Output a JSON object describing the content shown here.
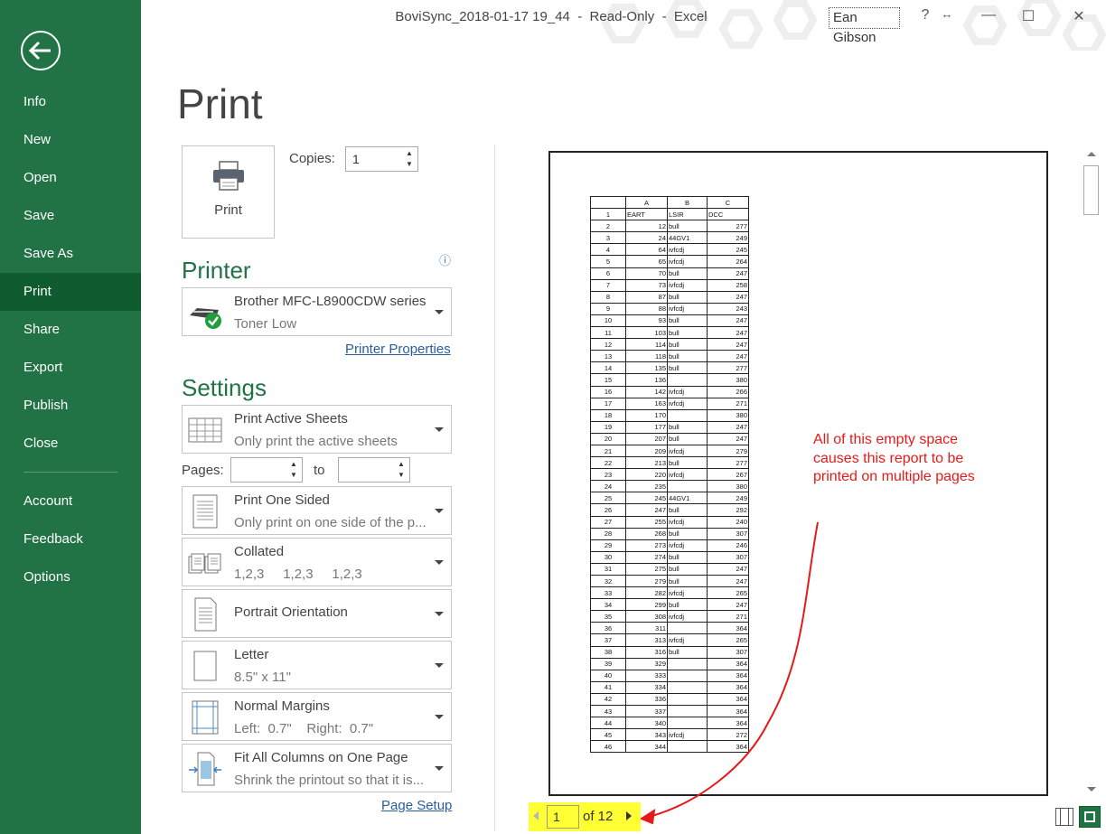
{
  "window": {
    "title": "BoviSync_2018-01-17 19_44  -  Read-Only  -  Excel",
    "user": "Ean Gibson",
    "help": "?",
    "minimize": "—",
    "maximize": "☐",
    "close": "✕"
  },
  "sidebar": {
    "items": [
      {
        "label": "Info"
      },
      {
        "label": "New"
      },
      {
        "label": "Open"
      },
      {
        "label": "Save"
      },
      {
        "label": "Save As"
      },
      {
        "label": "Print",
        "active": true
      },
      {
        "label": "Share"
      },
      {
        "label": "Export"
      },
      {
        "label": "Publish"
      },
      {
        "label": "Close"
      },
      {
        "label": "Account"
      },
      {
        "label": "Feedback"
      },
      {
        "label": "Options"
      }
    ]
  },
  "print": {
    "heading": "Print",
    "button_label": "Print",
    "copies_label": "Copies:",
    "copies_value": "1",
    "printer_heading": "Printer",
    "printer_name": "Brother MFC-L8900CDW series",
    "printer_status": "Toner Low",
    "printer_properties": "Printer Properties",
    "settings_heading": "Settings",
    "pages_label": "Pages:",
    "pages_to": "to",
    "page_setup": "Page Setup",
    "settings": [
      {
        "title": "Print Active Sheets",
        "subtitle": "Only print the active sheets"
      },
      {
        "title": "Print One Sided",
        "subtitle": "Only print on one side of the p..."
      },
      {
        "title": "Collated",
        "subtitle": "1,2,3     1,2,3     1,2,3"
      },
      {
        "title": "Portrait Orientation",
        "subtitle": ""
      },
      {
        "title": "Letter",
        "subtitle": "8.5\" x 11\""
      },
      {
        "title": "Normal Margins",
        "subtitle": "Left:  0.7\"    Right:  0.7\""
      },
      {
        "title": "Fit All Columns on One Page",
        "subtitle": "Shrink the printout so that it is..."
      }
    ]
  },
  "preview": {
    "columns": [
      "A",
      "B",
      "C"
    ],
    "header_row": [
      "1",
      "EART",
      "LSIR",
      "DCC"
    ],
    "rows": [
      [
        "2",
        "12",
        "bull",
        "277"
      ],
      [
        "3",
        "24",
        "44GV1",
        "249"
      ],
      [
        "4",
        "64",
        "ivfcdj",
        "245"
      ],
      [
        "5",
        "65",
        "ivfcdj",
        "264"
      ],
      [
        "6",
        "70",
        "bull",
        "247"
      ],
      [
        "7",
        "73",
        "ivfcdj",
        "258"
      ],
      [
        "8",
        "87",
        "bull",
        "247"
      ],
      [
        "9",
        "88",
        "ivfcdj",
        "243"
      ],
      [
        "10",
        "93",
        "bull",
        "247"
      ],
      [
        "11",
        "103",
        "bull",
        "247"
      ],
      [
        "12",
        "114",
        "bull",
        "247"
      ],
      [
        "13",
        "118",
        "bull",
        "247"
      ],
      [
        "14",
        "135",
        "bull",
        "277"
      ],
      [
        "15",
        "136",
        "",
        "380"
      ],
      [
        "16",
        "142",
        "ivfcdj",
        "266"
      ],
      [
        "17",
        "163",
        "ivfcdj",
        "271"
      ],
      [
        "18",
        "170",
        "",
        "380"
      ],
      [
        "19",
        "177",
        "bull",
        "247"
      ],
      [
        "20",
        "207",
        "bull",
        "247"
      ],
      [
        "21",
        "209",
        "ivfcdj",
        "279"
      ],
      [
        "22",
        "213",
        "bull",
        "277"
      ],
      [
        "23",
        "220",
        "ivfcdj",
        "267"
      ],
      [
        "24",
        "235",
        "",
        "380"
      ],
      [
        "25",
        "245",
        "44GV1",
        "249"
      ],
      [
        "26",
        "247",
        "bull",
        "292"
      ],
      [
        "27",
        "255",
        "ivfcdj",
        "240"
      ],
      [
        "28",
        "268",
        "bull",
        "307"
      ],
      [
        "29",
        "273",
        "ivfcdj",
        "246"
      ],
      [
        "30",
        "274",
        "bull",
        "307"
      ],
      [
        "31",
        "275",
        "bull",
        "247"
      ],
      [
        "32",
        "279",
        "bull",
        "247"
      ],
      [
        "33",
        "282",
        "ivfcdj",
        "265"
      ],
      [
        "34",
        "299",
        "bull",
        "247"
      ],
      [
        "35",
        "308",
        "ivfcdj",
        "271"
      ],
      [
        "36",
        "311",
        "",
        "364"
      ],
      [
        "37",
        "313",
        "ivfcdj",
        "265"
      ],
      [
        "38",
        "316",
        "bull",
        "307"
      ],
      [
        "39",
        "329",
        "",
        "364"
      ],
      [
        "40",
        "333",
        "",
        "364"
      ],
      [
        "41",
        "334",
        "",
        "364"
      ],
      [
        "42",
        "336",
        "",
        "364"
      ],
      [
        "43",
        "337",
        "",
        "364"
      ],
      [
        "44",
        "340",
        "",
        "364"
      ],
      [
        "45",
        "343",
        "ivfcdj",
        "272"
      ],
      [
        "46",
        "344",
        "",
        "364"
      ]
    ],
    "current_page": "1",
    "page_count_text": "of 12",
    "annotation": "All of this empty space causes this report to be printed on multiple pages"
  },
  "colors": {
    "sidebar": "#217346",
    "sidebar_active": "#0e5c30",
    "accent": "#217346",
    "annotation": "#e51a1a",
    "highlight": "#ffff33"
  }
}
